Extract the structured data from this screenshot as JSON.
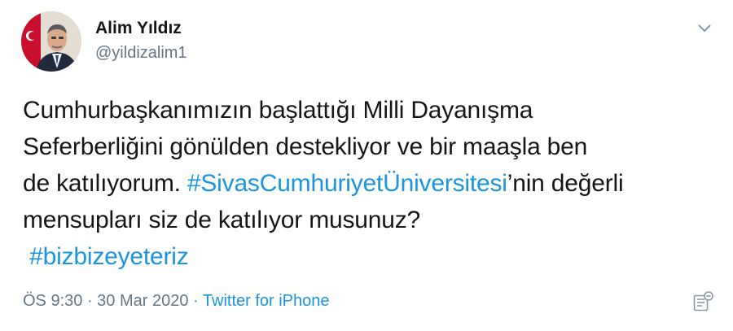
{
  "author": {
    "display_name": "Alim Yıldız",
    "handle": "@yildizalim1"
  },
  "tweet": {
    "line1": "Cumhurbaşkanımızın başlattığı Milli Dayanışma",
    "line2": "Seferberliğini gönülden destekliyor ve bir maaşla ben",
    "line3_before": "de katılıyorum. ",
    "line3_hashtag": "#SivasCumhuriyetÜniversitesi",
    "line3_after": "’nin değerli",
    "line4": "mensupları siz de katılıyor musunuz?",
    "line5_hashtag": "#bizbizeyeteriz"
  },
  "meta": {
    "time": "ÖS 9:30",
    "separator1": " · ",
    "date": "30 Mar 2020",
    "separator2": " · ",
    "source": "Twitter for iPhone"
  },
  "icons": {
    "menu": "chevron-down-icon",
    "analytics": "tweet-analytics-icon"
  },
  "colors": {
    "link": "#1b95e0",
    "secondary_text": "#657786",
    "primary_text": "#14171a"
  }
}
